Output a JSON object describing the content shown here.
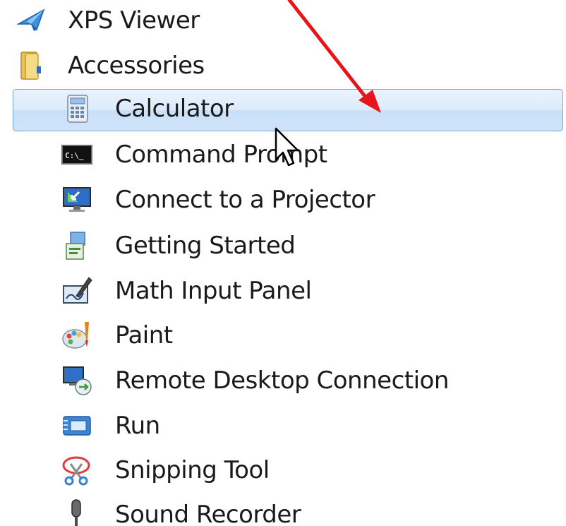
{
  "menu": {
    "items": [
      {
        "label": "XPS Viewer",
        "icon": "xps-viewer-icon",
        "level": "top"
      },
      {
        "label": "Accessories",
        "icon": "folder-icon",
        "level": "top"
      },
      {
        "label": "Calculator",
        "icon": "calculator-icon",
        "level": "child",
        "selected": true
      },
      {
        "label": "Command Prompt",
        "icon": "command-prompt-icon",
        "level": "child"
      },
      {
        "label": "Connect to a Projector",
        "icon": "projector-icon",
        "level": "child"
      },
      {
        "label": "Getting Started",
        "icon": "getting-started-icon",
        "level": "child"
      },
      {
        "label": "Math Input Panel",
        "icon": "math-input-icon",
        "level": "child"
      },
      {
        "label": "Paint",
        "icon": "paint-icon",
        "level": "child"
      },
      {
        "label": "Remote Desktop Connection",
        "icon": "remote-desktop-icon",
        "level": "child"
      },
      {
        "label": "Run",
        "icon": "run-icon",
        "level": "child"
      },
      {
        "label": "Snipping Tool",
        "icon": "snipping-tool-icon",
        "level": "child"
      },
      {
        "label": "Sound Recorder",
        "icon": "microphone-icon",
        "level": "child"
      }
    ]
  },
  "colors": {
    "selection_border": "#7da2ce",
    "selection_fill": "#dcebfc",
    "annotation_arrow": "#e8141a"
  }
}
